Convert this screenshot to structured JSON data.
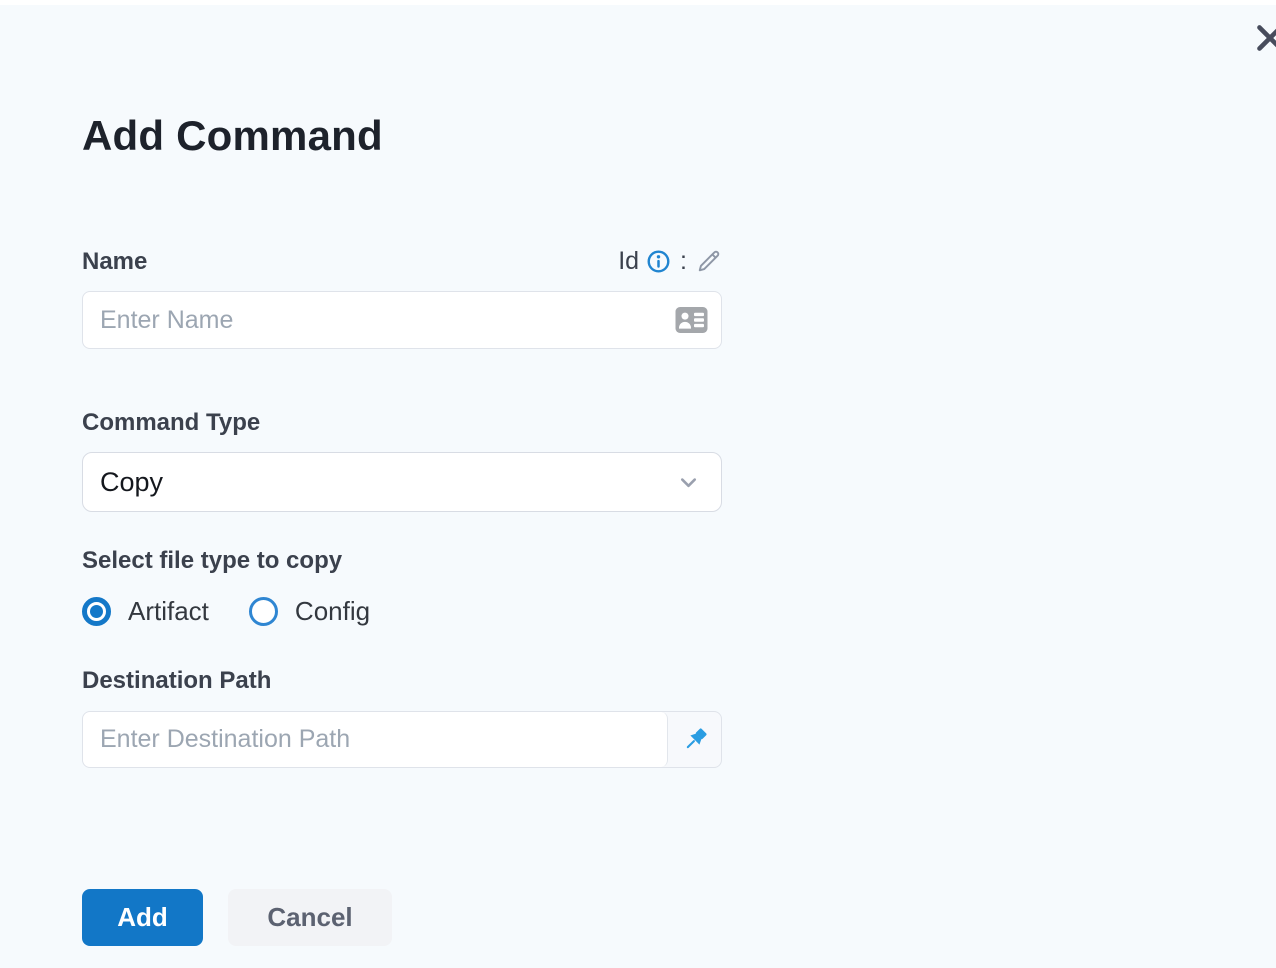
{
  "window": {
    "background_color": "#f6fafd",
    "close_icon": "x"
  },
  "header": {
    "title": "Add Command"
  },
  "form": {
    "name": {
      "label": "Name",
      "id_label": "Id",
      "separator": ":",
      "value": "",
      "input_placeholder": "Enter Name"
    },
    "command_type": {
      "label": "Command Type",
      "selected_option": "Copy"
    },
    "file_type": {
      "label": "Select file type to copy",
      "options": [
        {
          "label": "Artifact",
          "selected": true
        },
        {
          "label": "Config",
          "selected": false
        }
      ]
    },
    "destination": {
      "label": "Destination Path",
      "value": "",
      "input_placeholder": "Enter Destination Path"
    }
  },
  "actions": {
    "add_label": "Add",
    "cancel_label": "Cancel"
  },
  "colors": {
    "accent_blue": "#1277c7",
    "radio_blue": "#1478c8",
    "pin_blue": "#2a9de2",
    "info_blue": "#2185d0",
    "title_text": "#1d222b",
    "label_text": "#3b414d",
    "placeholder_text": "#9ca6b2",
    "cancel_bg": "#f2f3f6",
    "cancel_text": "#5c6271"
  }
}
